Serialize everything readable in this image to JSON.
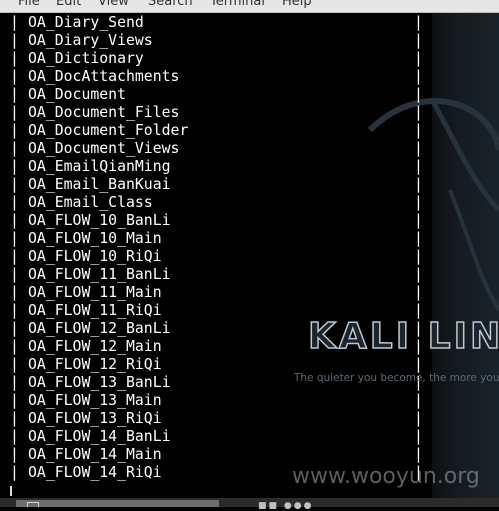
{
  "menubar": {
    "items": [
      "File",
      "Edit",
      "View",
      "Search",
      "Terminal",
      "Help"
    ]
  },
  "terminal": {
    "table_rows": [
      "OA_Diary_Send",
      "OA_Diary_Views",
      "OA_Dictionary",
      "OA_DocAttachments",
      "OA_Document",
      "OA_Document_Files",
      "OA_Document_Folder",
      "OA_Document_Views",
      "OA_EmailQianMing",
      "OA_Email_BanKuai",
      "OA_Email_Class",
      "OA_FLOW_10_BanLi",
      "OA_FLOW_10_Main",
      "OA_FLOW_10_RiQi",
      "OA_FLOW_11_BanLi",
      "OA_FLOW_11_Main",
      "OA_FLOW_11_RiQi",
      "OA_FLOW_12_BanLi",
      "OA_FLOW_12_Main",
      "OA_FLOW_12_RiQi",
      "OA_FLOW_13_BanLi",
      "OA_FLOW_13_Main",
      "OA_FLOW_13_RiQi",
      "OA_FLOW_14_BanLi",
      "OA_FLOW_14_Main",
      "OA_FLOW_14_RiQi"
    ],
    "pipe": "|"
  },
  "desktop": {
    "logo_text": "KALI LIN",
    "tagline": "The quieter you become, the more you"
  },
  "watermark": "www.wooyun.org",
  "taskbar": {
    "tray_text": "■■ ●●●"
  },
  "colors": {
    "terminal_bg": "#000000",
    "terminal_fg": "#ffffff",
    "menubar_bg": "#e6e6e6",
    "wallpaper": "#141b21",
    "taskbar_bg": "#2b2b2b"
  }
}
